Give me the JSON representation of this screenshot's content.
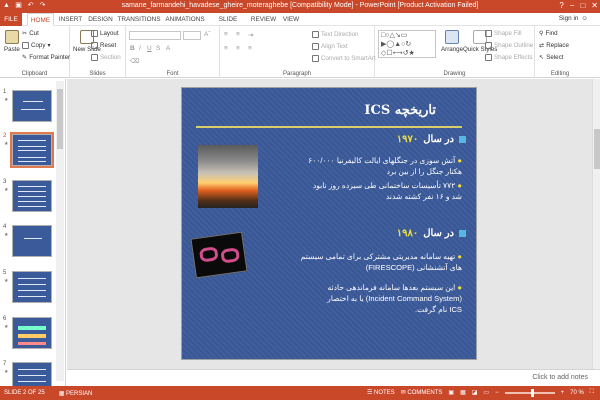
{
  "app": {
    "window_title": "samane_farmandehi_havadese_gheire_moteraghebe [Compatibility Mode] - PowerPoint [Product Activation Failed]",
    "signin": "Sign in",
    "window_controls": [
      "?",
      "−",
      "□",
      "✕"
    ]
  },
  "tabs": [
    {
      "label": "FILE"
    },
    {
      "label": "HOME"
    },
    {
      "label": "INSERT"
    },
    {
      "label": "DESIGN"
    },
    {
      "label": "TRANSITIONS"
    },
    {
      "label": "ANIMATIONS"
    },
    {
      "label": "SLIDE SHOW"
    },
    {
      "label": "REVIEW"
    },
    {
      "label": "VIEW"
    }
  ],
  "active_tab": "HOME",
  "ribbon": {
    "clipboard": {
      "label": "Clipboard",
      "paste": "Paste",
      "cut": "Cut",
      "copy": "Copy",
      "format_painter": "Format Painter"
    },
    "slides": {
      "label": "Slides",
      "new_slide": "New Slide",
      "layout": "Layout",
      "reset": "Reset",
      "section": "Section"
    },
    "font": {
      "label": "Font"
    },
    "paragraph": {
      "label": "Paragraph",
      "text_direction": "Text Direction",
      "align_text": "Align Text",
      "convert_smartart": "Convert to SmartArt"
    },
    "drawing": {
      "label": "Drawing",
      "arrange": "Arrange",
      "quick_styles": "Quick Styles",
      "shape_fill": "Shape Fill",
      "shape_outline": "Shape Outline",
      "shape_effects": "Shape Effects"
    },
    "editing": {
      "label": "Editing",
      "find": "Find",
      "replace": "Replace",
      "select": "Select"
    }
  },
  "thumbnails": [
    {
      "num": "1"
    },
    {
      "num": "2"
    },
    {
      "num": "3"
    },
    {
      "num": "4"
    },
    {
      "num": "5"
    },
    {
      "num": "6"
    },
    {
      "num": "7"
    }
  ],
  "selected_slide": 2,
  "slide": {
    "title": "تاریخچه ICS",
    "sections": [
      {
        "heading": "در سال",
        "year": "۱۹۷۰",
        "bullets": [
          [
            "آتش سوزی در جنگلهای ایالت کالیفرنیا ۶۰۰/۰۰۰",
            "هکتار جنگل را از بین برد"
          ],
          [
            "۷۷۲ تأسیسات ساختمانی طی سیزده روز نابود",
            "شد و ۱۶ نفر کشته شدند"
          ]
        ]
      },
      {
        "heading": "در سال",
        "year": "۱۹۸۰",
        "bullets": [
          [
            "تهیه سامانه مدیریتی مشترکی برای تمامی سیستم",
            "های آتشنشانی (FIRESCOPE)"
          ],
          [
            "این سیستم بعدها سامانه فرماندهی حادثه",
            "(Incident Command System) یا به اختصار",
            "ICS نام گرفت."
          ]
        ]
      }
    ]
  },
  "notes_placeholder": "Click to add notes",
  "status": {
    "slide_info": "SLIDE 2 OF 25",
    "language": "PERSIAN",
    "notes": "NOTES",
    "comments": "COMMENTS",
    "zoom": "70 %",
    "zoom_level": 0.55
  },
  "colors": {
    "accent": "#c9482a",
    "slide_bg": "#3b5a99",
    "year": "#f2df3f",
    "bullet_square": "#57b7df"
  }
}
